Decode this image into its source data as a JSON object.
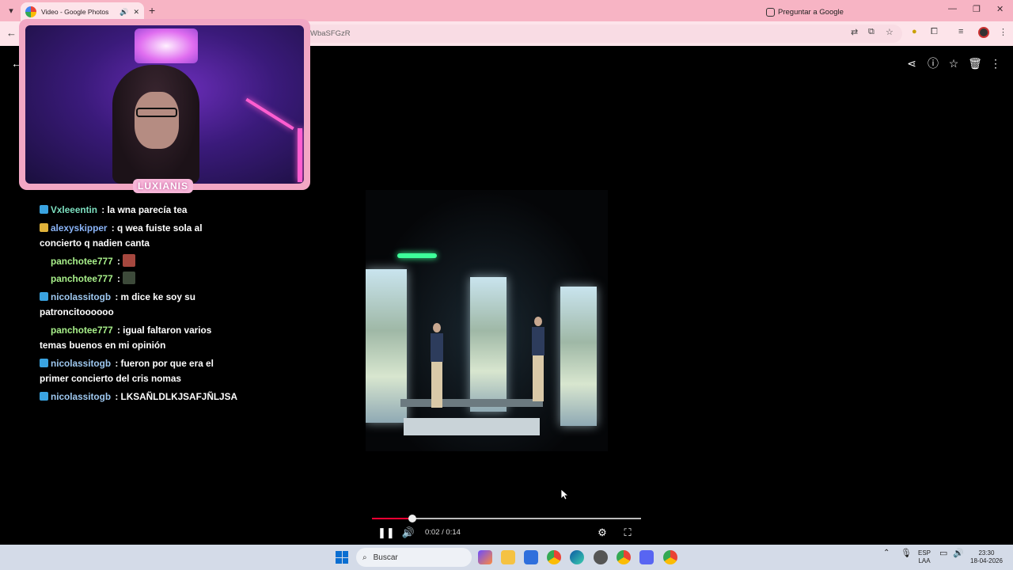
{
  "browser": {
    "tab_title": "Video - Google Photos",
    "url_fragment": "WbaSFGzR",
    "ask_google_label": "Preguntar a Google"
  },
  "video": {
    "time_display": "0:02 / 0:14",
    "progress": 0.15
  },
  "webcam": {
    "logo_text": "LUXIANIS"
  },
  "chat": {
    "messages": [
      {
        "user": "Vxleeentin",
        "user_color": "#7de0c0",
        "text": "la wna parecía tea"
      },
      {
        "user": "alexyskipper",
        "user_color": "#8ab4f8",
        "text": "q wea fuiste sola al concierto q nadien canta"
      },
      {
        "user": "panchotee777",
        "user_color": "#a8f08a",
        "text": ""
      },
      {
        "user": "panchotee777",
        "user_color": "#a8f08a",
        "text": ""
      },
      {
        "user": "nicolassitogb",
        "user_color": "#9ec8f0",
        "text": "m dice ke soy su patroncitoooooo"
      },
      {
        "user": "panchotee777",
        "user_color": "#a8f08a",
        "text": "igual faltaron varios temas buenos en mi opinión"
      },
      {
        "user": "nicolassitogb",
        "user_color": "#9ec8f0",
        "text": "fueron por que era el primer concierto del cris nomas"
      },
      {
        "user": "nicolassitogb",
        "user_color": "#9ec8f0",
        "text": "LKSAÑLDLKJSAFJÑLJSA"
      }
    ]
  },
  "taskbar": {
    "search_label": "Buscar",
    "lang_top": "ESP",
    "lang_bottom": "LAA",
    "clock_time": "23:30",
    "clock_date": "18-04-2026"
  }
}
